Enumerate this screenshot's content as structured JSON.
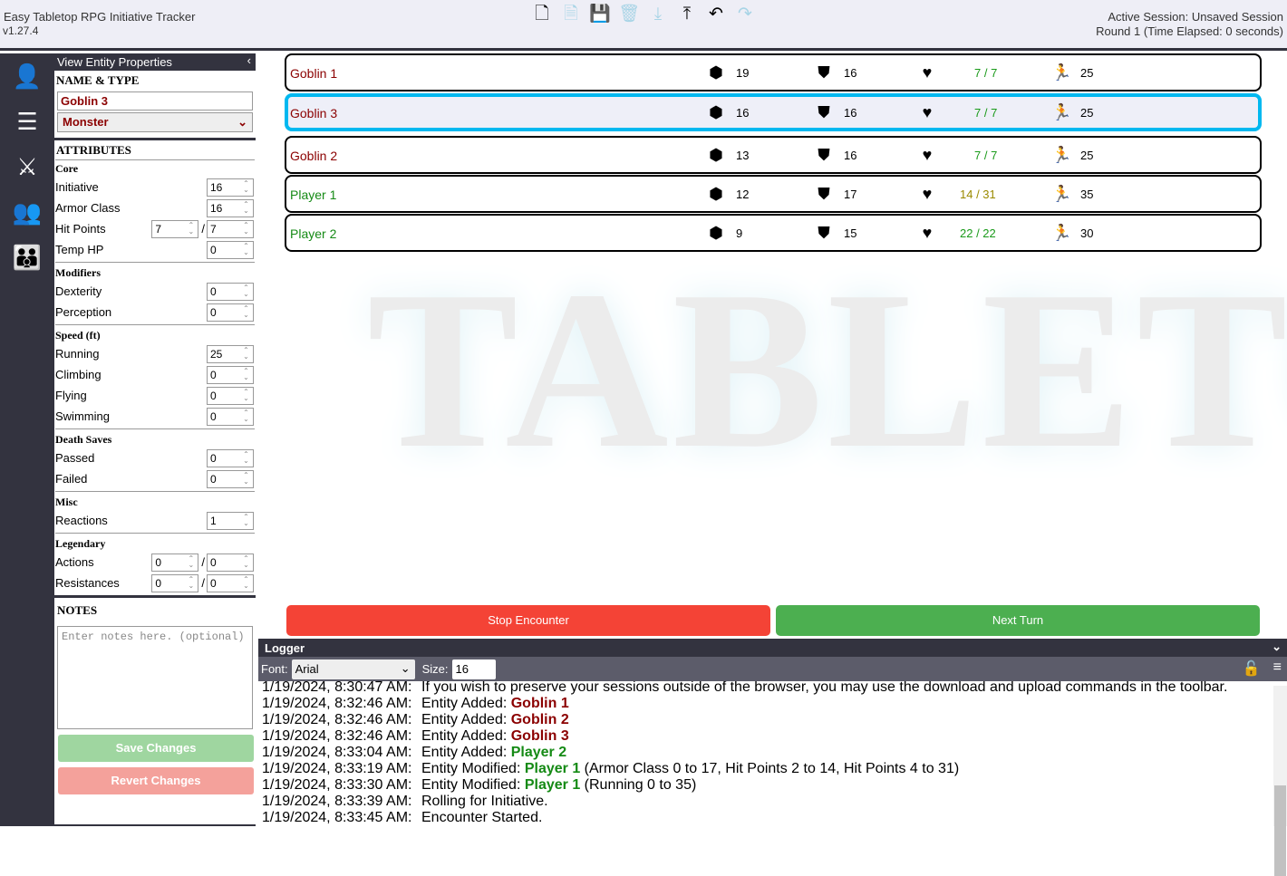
{
  "app": {
    "title": "Easy Tabletop RPG Initiative Tracker",
    "version": "v1.27.4",
    "session": "Active Session: Unsaved Session",
    "round": "Round 1 (Time Elapsed: 0 seconds)"
  },
  "toolbar": [
    {
      "icon": "new-file-icon",
      "glyph": "🗋",
      "enabled": true
    },
    {
      "icon": "open-file-icon",
      "glyph": "🗎",
      "enabled": false
    },
    {
      "icon": "save-edit-icon",
      "glyph": "💾",
      "enabled": true
    },
    {
      "icon": "trash-icon",
      "glyph": "🗑",
      "enabled": false
    },
    {
      "icon": "download-icon",
      "glyph": "⤓",
      "enabled": false
    },
    {
      "icon": "upload-icon",
      "glyph": "⤒",
      "enabled": true
    },
    {
      "icon": "undo-icon",
      "glyph": "↶",
      "enabled": true
    },
    {
      "icon": "redo-icon",
      "glyph": "↷",
      "enabled": false
    }
  ],
  "sidebar": [
    "add-user-icon",
    "edit-list-icon",
    "combat-swords-icon",
    "group-icon",
    "party-icon"
  ],
  "props": {
    "header": "View Entity Properties",
    "name_type": "NAME & TYPE",
    "name": "Goblin 3",
    "type": "Monster",
    "attributes": "ATTRIBUTES",
    "core": "Core",
    "initiative": {
      "label": "Initiative",
      "value": "16"
    },
    "armor_class": {
      "label": "Armor Class",
      "value": "16"
    },
    "hit_points": {
      "label": "Hit Points",
      "current": "7",
      "max": "7"
    },
    "temp_hp": {
      "label": "Temp HP",
      "value": "0"
    },
    "modifiers": "Modifiers",
    "dexterity": {
      "label": "Dexterity",
      "value": "0"
    },
    "perception": {
      "label": "Perception",
      "value": "0"
    },
    "speed": "Speed (ft)",
    "running": {
      "label": "Running",
      "value": "25"
    },
    "climbing": {
      "label": "Climbing",
      "value": "0"
    },
    "flying": {
      "label": "Flying",
      "value": "0"
    },
    "swimming": {
      "label": "Swimming",
      "value": "0"
    },
    "death_saves": "Death Saves",
    "passed": {
      "label": "Passed",
      "value": "0"
    },
    "failed": {
      "label": "Failed",
      "value": "0"
    },
    "misc": "Misc",
    "reactions": {
      "label": "Reactions",
      "value": "1"
    },
    "legendary": "Legendary",
    "actions": {
      "label": "Actions",
      "current": "0",
      "max": "0"
    },
    "resistances": {
      "label": "Resistances",
      "current": "0",
      "max": "0"
    },
    "notes": "NOTES",
    "notes_placeholder": "Enter notes here. (optional)",
    "save": "Save Changes",
    "revert": "Revert Changes"
  },
  "entities": [
    {
      "name": "Goblin 1",
      "initiative": "19",
      "ac": "16",
      "hp": "7 / 7",
      "speed": "25",
      "color": "#8b0000",
      "hp_color": "#1a9a1a",
      "active": false
    },
    {
      "name": "Goblin 3",
      "initiative": "16",
      "ac": "16",
      "hp": "7 / 7",
      "speed": "25",
      "color": "#8b0000",
      "hp_color": "#1a9a1a",
      "active": true
    },
    {
      "name": "Goblin 2",
      "initiative": "13",
      "ac": "16",
      "hp": "7 / 7",
      "speed": "25",
      "color": "#8b0000",
      "hp_color": "#1a9a1a",
      "active": false
    },
    {
      "name": "Player 1",
      "initiative": "12",
      "ac": "17",
      "hp": "14 / 31",
      "speed": "35",
      "color": "#158a15",
      "hp_color": "#9a8a00",
      "active": false
    },
    {
      "name": "Player 2",
      "initiative": "9",
      "ac": "15",
      "hp": "22 / 22",
      "speed": "30",
      "color": "#158a15",
      "hp_color": "#1a9a1a",
      "active": false
    }
  ],
  "watermark": "TABLETOP",
  "buttons": {
    "stop": "Stop Encounter",
    "next": "Next Turn"
  },
  "logger": {
    "title": "Logger",
    "font_label": "Font:",
    "font": "Arial",
    "size_label": "Size:",
    "size": "16",
    "lines": [
      {
        "ts": "1/19/2024, 8:30:47 AM:",
        "text": "If you wish to preserve your sessions outside of the browser, you may use the download and upload commands in the toolbar.",
        "entity": "",
        "suffix": ""
      },
      {
        "ts": "1/19/2024, 8:32:46 AM:",
        "text": "Entity Added: ",
        "entity": "Goblin 1",
        "color": "#8b0000",
        "suffix": ""
      },
      {
        "ts": "1/19/2024, 8:32:46 AM:",
        "text": "Entity Added: ",
        "entity": "Goblin 2",
        "color": "#8b0000",
        "suffix": ""
      },
      {
        "ts": "1/19/2024, 8:32:46 AM:",
        "text": "Entity Added: ",
        "entity": "Goblin 3",
        "color": "#8b0000",
        "suffix": ""
      },
      {
        "ts": "1/19/2024, 8:33:04 AM:",
        "text": "Entity Added: ",
        "entity": "Player 2",
        "color": "#158a15",
        "suffix": ""
      },
      {
        "ts": "1/19/2024, 8:33:19 AM:",
        "text": "Entity Modified: ",
        "entity": "Player 1",
        "color": "#158a15",
        "suffix": " (Armor Class 0 to 17, Hit Points 2 to 14, Hit Points 4 to 31)"
      },
      {
        "ts": "1/19/2024, 8:33:30 AM:",
        "text": "Entity Modified: ",
        "entity": "Player 1",
        "color": "#158a15",
        "suffix": " (Running 0 to 35)"
      },
      {
        "ts": "1/19/2024, 8:33:39 AM:",
        "text": "Rolling for Initiative.",
        "entity": "",
        "suffix": ""
      },
      {
        "ts": "1/19/2024, 8:33:45 AM:",
        "text": "Encounter Started.",
        "entity": "",
        "suffix": ""
      }
    ]
  }
}
